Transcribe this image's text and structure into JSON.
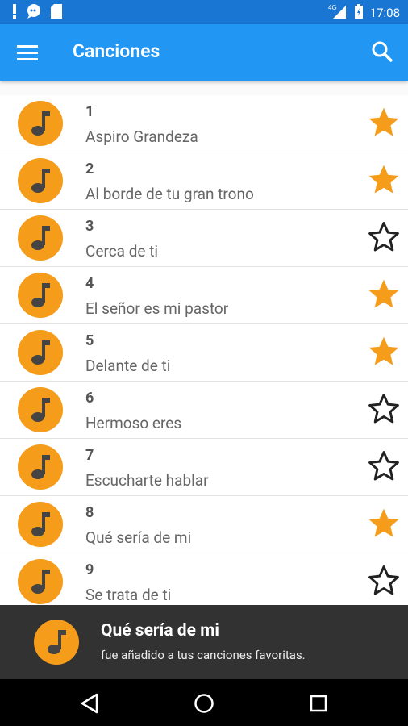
{
  "status_bar": {
    "time": "17:08",
    "network": "4G",
    "left_icons": [
      "alert-icon",
      "chat-icon",
      "sd-card-icon"
    ],
    "right_icons": [
      "signal-icon",
      "battery-icon"
    ]
  },
  "app_bar": {
    "title": "Canciones",
    "color": "#2196f3"
  },
  "songs": [
    {
      "number": "1",
      "title": "Aspiro Grandeza",
      "favorite": true
    },
    {
      "number": "2",
      "title": "Al borde de tu gran trono",
      "favorite": true
    },
    {
      "number": "3",
      "title": "Cerca de ti",
      "favorite": false
    },
    {
      "number": "4",
      "title": "El señor es mi pastor",
      "favorite": true
    },
    {
      "number": "5",
      "title": "Delante de ti",
      "favorite": true
    },
    {
      "number": "6",
      "title": "Hermoso eres",
      "favorite": false
    },
    {
      "number": "7",
      "title": "Escucharte hablar",
      "favorite": false
    },
    {
      "number": "8",
      "title": "Qué sería de mi",
      "favorite": true
    },
    {
      "number": "9",
      "title": "Se trata de ti",
      "favorite": false
    }
  ],
  "snackbar": {
    "title": "Qué sería de mi",
    "message": "fue añadido a tus canciones favoritas."
  },
  "colors": {
    "accent": "#f59c1a",
    "primary": "#2196f3",
    "status_bar": "#1976d2"
  }
}
